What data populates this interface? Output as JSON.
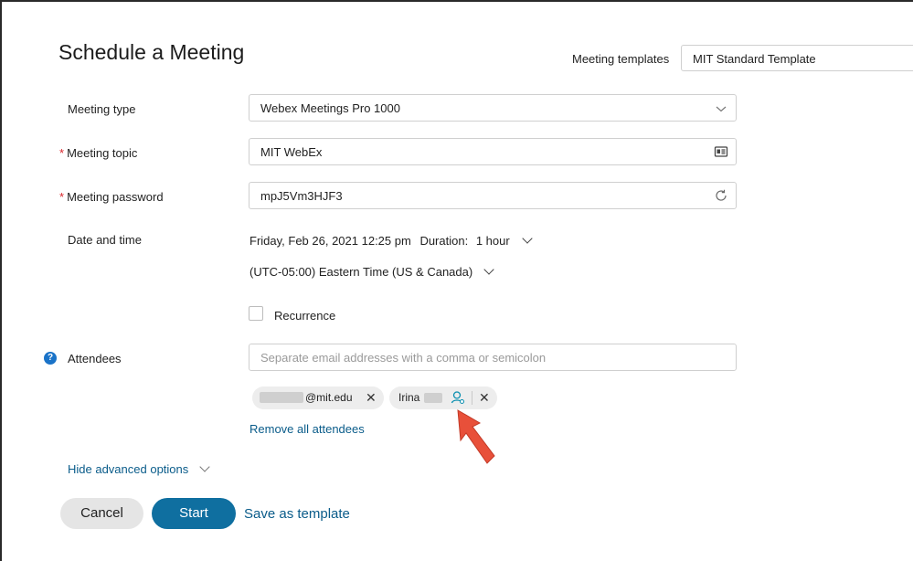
{
  "header": {
    "title": "Schedule a Meeting"
  },
  "templates": {
    "label": "Meeting templates",
    "value": "MIT Standard Template"
  },
  "form": {
    "meeting_type": {
      "label": "Meeting type",
      "value": "Webex Meetings Pro 1000"
    },
    "topic": {
      "required_mark": "*",
      "label": "Meeting topic",
      "value": "MIT WebEx"
    },
    "password": {
      "required_mark": "*",
      "label": "Meeting password",
      "value": "mpJ5Vm3HJF3"
    },
    "datetime": {
      "label": "Date and time",
      "date": "Friday, Feb 26, 2021 12:25 pm",
      "duration_label": "Duration:",
      "duration_value": "1 hour",
      "timezone": "(UTC-05:00) Eastern Time (US & Canada)"
    },
    "recurrence": {
      "label": "Recurrence",
      "checked": false
    },
    "attendees": {
      "help": "?",
      "label": "Attendees",
      "placeholder": "Separate email addresses with a comma or semicolon",
      "chips": [
        {
          "text": "@mit.edu"
        },
        {
          "text": "Irina"
        }
      ],
      "remove_all": "Remove all attendees"
    },
    "advanced": {
      "label": "Hide advanced options"
    }
  },
  "actions": {
    "cancel": "Cancel",
    "start": "Start",
    "save_template": "Save as template"
  },
  "colors": {
    "primary": "#0f6fa0",
    "link": "#0a5c8a",
    "required": "#d9252a",
    "arrow": "#e8503a"
  }
}
